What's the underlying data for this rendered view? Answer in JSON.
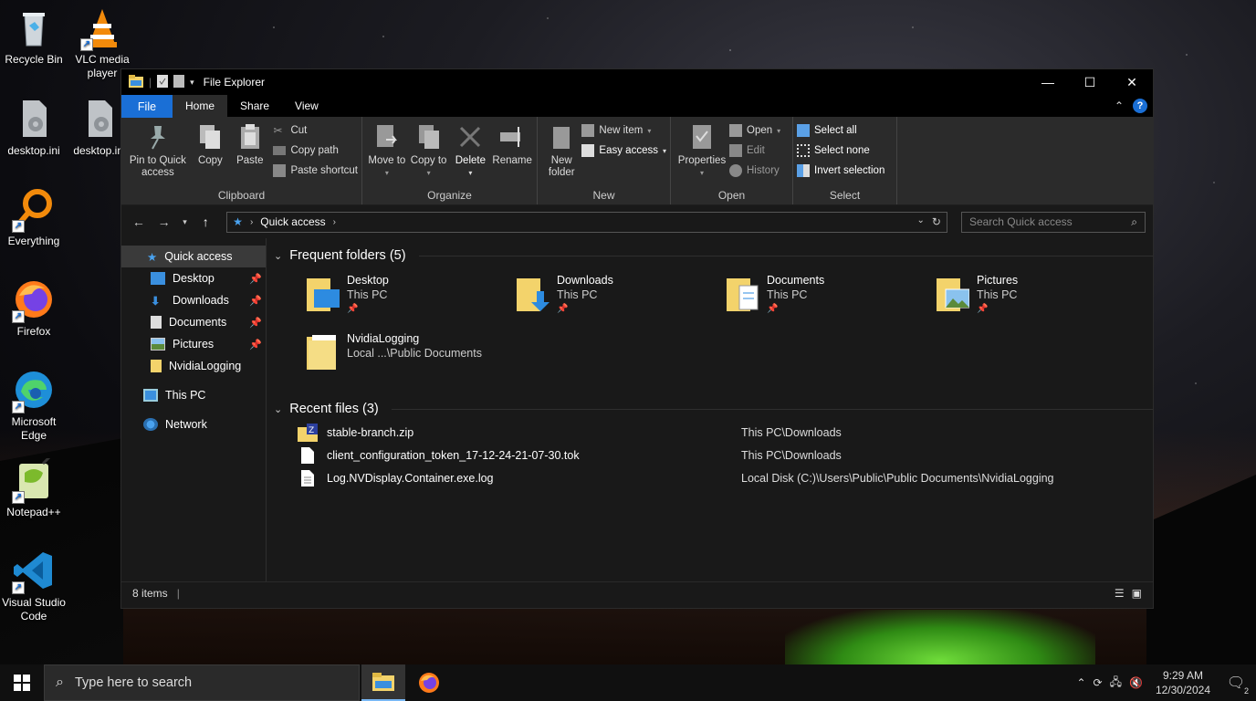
{
  "desktop": {
    "icons": [
      {
        "label": "Recycle Bin"
      },
      {
        "label": "VLC media player"
      },
      {
        "label": "desktop.ini"
      },
      {
        "label": "desktop.ini"
      },
      {
        "label": "Everything"
      },
      {
        "label": "Firefox"
      },
      {
        "label": "Microsoft Edge"
      },
      {
        "label": "Notepad++"
      },
      {
        "label": "Visual Studio Code"
      }
    ]
  },
  "window": {
    "title": "File Explorer",
    "tabs": [
      "File",
      "Home",
      "Share",
      "View"
    ],
    "ribbon": {
      "clipboard": {
        "label": "Clipboard",
        "pin": "Pin to Quick access",
        "copy": "Copy",
        "paste": "Paste",
        "cut": "Cut",
        "copy_path": "Copy path",
        "paste_shortcut": "Paste shortcut"
      },
      "organize": {
        "label": "Organize",
        "move_to": "Move to",
        "copy_to": "Copy to",
        "delete": "Delete",
        "rename": "Rename"
      },
      "new": {
        "label": "New",
        "new_folder": "New folder",
        "new_item": "New item",
        "easy_access": "Easy access"
      },
      "open": {
        "label": "Open",
        "properties": "Properties",
        "open": "Open",
        "edit": "Edit",
        "history": "History"
      },
      "select": {
        "label": "Select",
        "select_all": "Select all",
        "select_none": "Select none",
        "invert": "Invert selection"
      }
    },
    "address": {
      "path": "Quick access",
      "search_placeholder": "Search Quick access"
    },
    "nav": [
      {
        "label": "Quick access",
        "selected": true
      },
      {
        "label": "Desktop",
        "pinned": true
      },
      {
        "label": "Downloads",
        "pinned": true
      },
      {
        "label": "Documents",
        "pinned": true
      },
      {
        "label": "Pictures",
        "pinned": true
      },
      {
        "label": "NvidiaLogging"
      },
      {
        "label": "This PC"
      },
      {
        "label": "Network"
      }
    ],
    "frequent": {
      "header": "Frequent folders (5)",
      "folders": [
        {
          "name": "Desktop",
          "location": "This PC"
        },
        {
          "name": "Downloads",
          "location": "This PC"
        },
        {
          "name": "Documents",
          "location": "This PC"
        },
        {
          "name": "Pictures",
          "location": "This PC"
        },
        {
          "name": "NvidiaLogging",
          "location": "Local ...\\Public Documents"
        }
      ]
    },
    "recent": {
      "header": "Recent files (3)",
      "files": [
        {
          "name": "stable-branch.zip",
          "location": "This PC\\Downloads"
        },
        {
          "name": "client_configuration_token_17-12-24-21-07-30.tok",
          "location": "This PC\\Downloads"
        },
        {
          "name": "Log.NVDisplay.Container.exe.log",
          "location": "Local Disk (C:)\\Users\\Public\\Public Documents\\NvidiaLogging"
        }
      ]
    },
    "status": {
      "items": "8 items"
    }
  },
  "taskbar": {
    "search_placeholder": "Type here to search",
    "time": "9:29 AM",
    "date": "12/30/2024",
    "notification_count": "2"
  },
  "colors": {
    "accent": "#1a6fd6",
    "folder": "#f3d36b"
  }
}
